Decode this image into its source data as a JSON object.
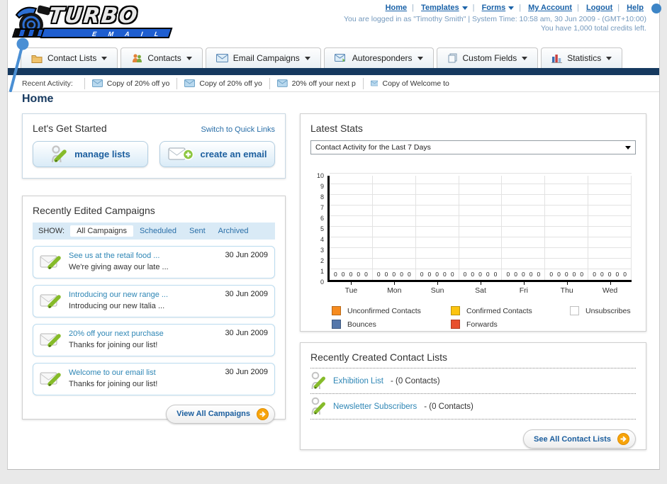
{
  "header": {
    "logo_title": "TURBO",
    "logo_subtitle": "E M A I L",
    "nav": [
      {
        "label": "Home",
        "dropdown": false
      },
      {
        "label": "Templates",
        "dropdown": true
      },
      {
        "label": "Forms",
        "dropdown": true
      },
      {
        "label": "My Account",
        "dropdown": false
      },
      {
        "label": "Logout",
        "dropdown": false
      },
      {
        "label": "Help",
        "dropdown": false
      }
    ],
    "login_info": "You are logged in as \"Timothy Smith\" | System Time: 10:58 am, 30 Jun 2009 - (GMT+10:00)",
    "credits_info": "You have 1,000 total credits left."
  },
  "tabs": [
    {
      "label": "Contact Lists"
    },
    {
      "label": "Contacts"
    },
    {
      "label": "Email Campaigns"
    },
    {
      "label": "Autoresponders"
    },
    {
      "label": "Custom Fields"
    },
    {
      "label": "Statistics"
    }
  ],
  "recent_activity": {
    "label": "Recent Activity:",
    "items": [
      "Copy of 20% off yo",
      "Copy of 20% off yo",
      "20% off your next p",
      "Copy of Welcome to"
    ]
  },
  "page_title": "Home",
  "get_started": {
    "title": "Let's Get Started",
    "switch_link": "Switch to Quick Links",
    "manage_lists_label": "manage lists",
    "create_email_label": "create an email"
  },
  "campaigns": {
    "title": "Recently Edited Campaigns",
    "show_label": "SHOW:",
    "filters": [
      "All Campaigns",
      "Scheduled",
      "Sent",
      "Archived"
    ],
    "active_filter": "All Campaigns",
    "items": [
      {
        "title": "See us at the retail food ...",
        "subtitle": "We're giving away our late ...",
        "date": "30 Jun 2009"
      },
      {
        "title": "Introducing our new range ...",
        "subtitle": "Introducing our new Italia ...",
        "date": "30 Jun 2009"
      },
      {
        "title": "20% off your next purchase",
        "subtitle": "Thanks for joining our list!",
        "date": "30 Jun 2009"
      },
      {
        "title": "Welcome to our email list",
        "subtitle": "Thanks for joining our list!",
        "date": "30 Jun 2009"
      }
    ],
    "view_all_label": "View All Campaigns"
  },
  "stats": {
    "title": "Latest Stats",
    "dropdown_value": "Contact Activity for the Last 7 Days"
  },
  "chart_data": {
    "type": "bar",
    "title": "Contact Activity for the Last 7 Days",
    "categories": [
      "Tue",
      "Mon",
      "Sun",
      "Sat",
      "Fri",
      "Thu",
      "Wed"
    ],
    "series": [
      {
        "name": "Unconfirmed Contacts",
        "color": "#f68b1f",
        "values": [
          0,
          0,
          0,
          0,
          0,
          0,
          0
        ]
      },
      {
        "name": "Confirmed Contacts",
        "color": "#fcc410",
        "values": [
          0,
          0,
          0,
          0,
          0,
          0,
          0
        ]
      },
      {
        "name": "Unsubscribes",
        "color": "#73a washes533",
        "values": [
          0,
          0,
          0,
          0,
          0,
          0,
          0
        ]
      },
      {
        "name": "Bounces",
        "color": "#5577aa",
        "values": [
          0,
          0,
          0,
          0,
          0,
          0,
          0
        ]
      },
      {
        "name": "Forwards",
        "color": "#e8502e",
        "values": [
          0,
          0,
          0,
          0,
          0,
          0,
          0
        ]
      }
    ],
    "xlabel": "",
    "ylabel": "",
    "ylim": [
      0,
      10
    ],
    "ytick_step": 1,
    "grid": true,
    "legend_position": "bottom"
  },
  "contact_lists": {
    "title": "Recently Created Contact Lists",
    "items": [
      {
        "name": "Exhibition List",
        "detail": "- (0 Contacts)"
      },
      {
        "name": "Newsletter Subscribers",
        "detail": "- (0 Contacts)"
      }
    ],
    "see_all_label": "See All Contact Lists"
  },
  "colors": {
    "navy_bar": "#16395f",
    "link_blue": "#2a6fa8",
    "button_text_blue": "#1b5e9e",
    "filter_bar_bg": "#d9eaf6",
    "arrow_circle_orange": "#f7a40a"
  }
}
